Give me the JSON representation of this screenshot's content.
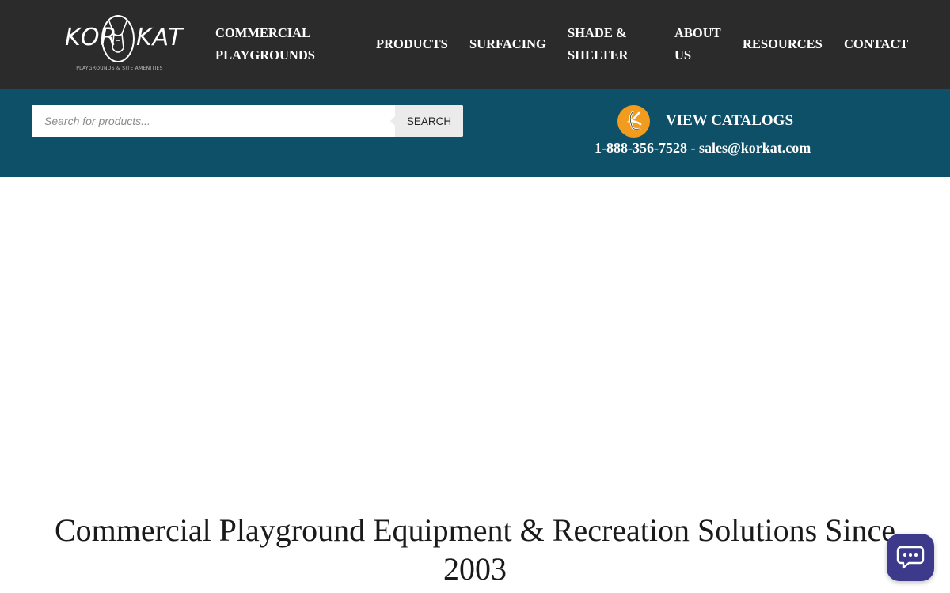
{
  "brand": {
    "logo_left": "KOR",
    "logo_right": "KAT",
    "tagline": "PLAYGROUNDS & SITE AMENITIES"
  },
  "nav": {
    "items": [
      {
        "label_line1": "COMMERCIAL",
        "label_line2": "PLAYGROUNDS"
      },
      {
        "label_line1": "PRODUCTS",
        "label_line2": ""
      },
      {
        "label_line1": "SURFACING",
        "label_line2": ""
      },
      {
        "label_line1": "SHADE &",
        "label_line2": "SHELTER"
      },
      {
        "label_line1": "ABOUT",
        "label_line2": "US"
      },
      {
        "label_line1": "RESOURCES",
        "label_line2": ""
      },
      {
        "label_line1": "CONTACT",
        "label_line2": ""
      }
    ]
  },
  "search": {
    "placeholder": "Search for products...",
    "value": "",
    "button_label": "SEARCH"
  },
  "catalogs": {
    "label": "VIEW CATALOGS",
    "icon": "korkat-k-badge-icon"
  },
  "contact": {
    "line": "1-888-356-7528 - sales@korkat.com"
  },
  "hero": {
    "title": "Commercial Playground Equipment & Recreation Solutions Since 2003"
  },
  "chat": {
    "icon": "chat-bubble-icon"
  },
  "colors": {
    "topbar": "#2b2b2b",
    "bluebar": "#0e5068",
    "catalog_badge": "#f29c1f",
    "chat_button": "#3d3a8c"
  }
}
